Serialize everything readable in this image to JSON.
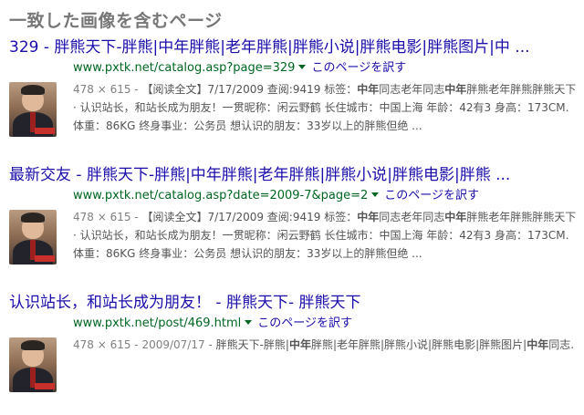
{
  "heading": "一致した画像を含むページ",
  "results": [
    {
      "title": "329 - 胖熊天下-胖熊|中年胖熊|老年胖熊|胖熊小说|胖熊电影|胖熊图片|中 ...",
      "url": "www.pxtk.net/catalog.asp?page=329",
      "translate": "このページを訳す",
      "meta": "478 × 615 - ",
      "s1": "【阅读全文】7/17/2009 查阅:9419 标签：",
      "b1": "中年",
      "s2": "同志老年同志",
      "b2": "中年",
      "s3": "胖熊老年胖熊胖熊天下 · 认识站长，和站长成为朋友！一贯昵称：闲云野鹤 长住城市：中国上海 年龄：42有3 身高：173CM. 体重：86KG 终身事业：公务员 想认识的朋友：33岁以上的胖熊但绝 ..."
    },
    {
      "title": "最新交友 - 胖熊天下-胖熊|中年胖熊|老年胖熊|胖熊小说|胖熊电影|胖熊 ...",
      "url": "www.pxtk.net/catalog.asp?date=2009-7&page=2",
      "translate": "このページを訳す",
      "meta": "478 × 615 - ",
      "s1": "【阅读全文】7/17/2009 查阅:9419 标签：",
      "b1": "中年",
      "s2": "同志老年同志",
      "b2": "中年",
      "s3": "胖熊老年胖熊胖熊天下 · 认识站长，和站长成为朋友！一贯昵称：闲云野鹤 长住城市：中国上海 年龄：42有3 身高：173CM. 体重：86KG 终身事业：公务员 想认识的朋友：33岁以上的胖熊但绝 ..."
    },
    {
      "title": "认识站长，和站长成为朋友！ - 胖熊天下- 胖熊天下",
      "url": "www.pxtk.net/post/469.html",
      "translate": "このページを訳す",
      "meta": "478 × 615 - 2009/07/17 - ",
      "s1": "胖熊天下-胖熊|",
      "b1": "中年",
      "s2": "胖熊|老年胖熊|胖熊小说|胖熊电影|胖熊图片|",
      "b2": "中年",
      "s3": "同志."
    }
  ]
}
